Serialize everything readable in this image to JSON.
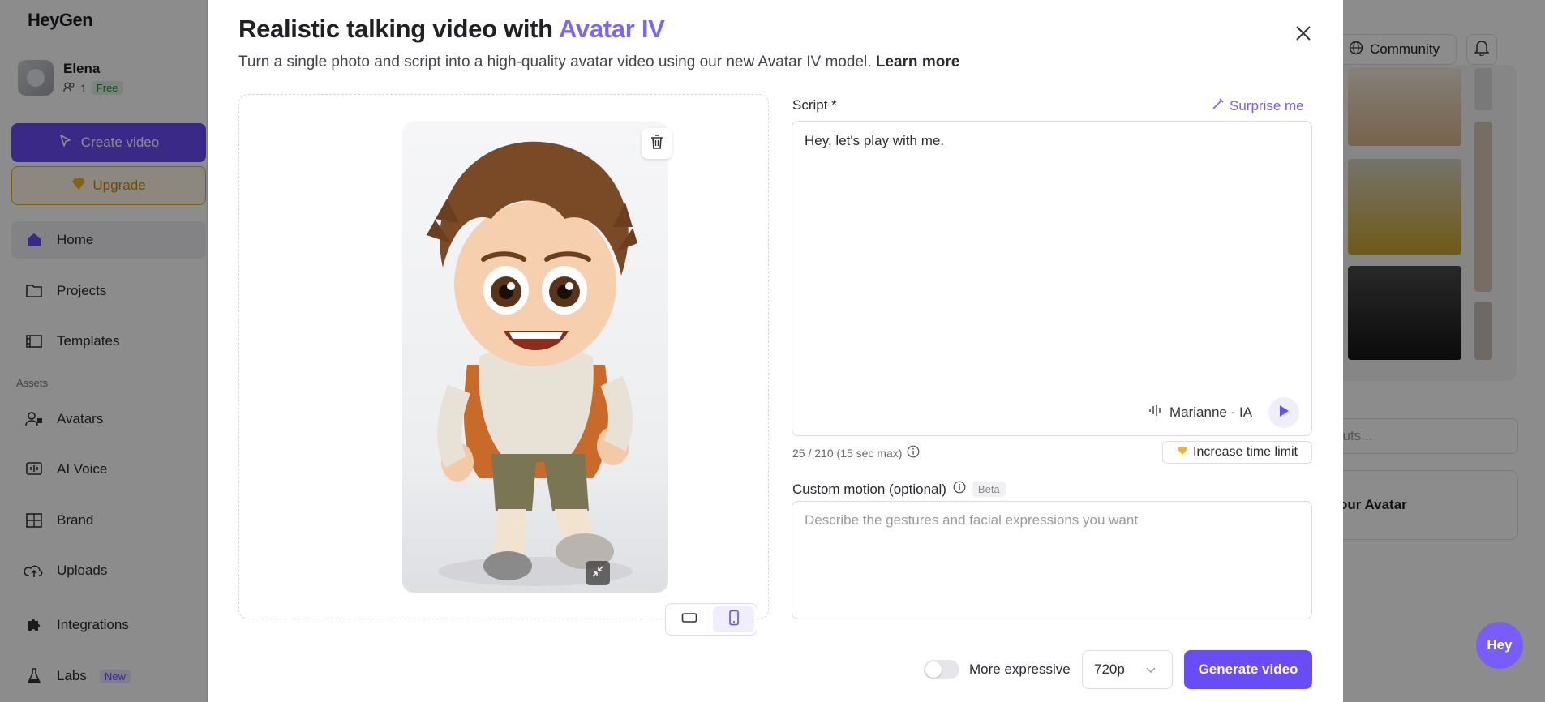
{
  "sidebar": {
    "logo": "HeyGen",
    "user": {
      "name": "Elena",
      "members": "1",
      "plan": "Free"
    },
    "create_label": "Create video",
    "upgrade_label": "Upgrade",
    "items": [
      {
        "label": "Home"
      },
      {
        "label": "Projects"
      },
      {
        "label": "Templates"
      },
      {
        "label": "Avatars"
      },
      {
        "label": "AI Voice"
      },
      {
        "label": "Brand"
      },
      {
        "label": "Uploads"
      },
      {
        "label": "Integrations"
      },
      {
        "label": "Labs",
        "badge": "New"
      }
    ],
    "assets_label": "Assets"
  },
  "background": {
    "community_label": "Community",
    "search_placeholder": "cuts...",
    "avatar_card_label": "our Avatar",
    "fab_label": "Hey"
  },
  "modal": {
    "title_prefix": "Realistic talking video with ",
    "title_accent": "Avatar IV",
    "subtitle": "Turn a single photo and script into a high-quality avatar video using our new Avatar IV model.",
    "learn_more": "Learn more",
    "script_label": "Script *",
    "surprise_label": "Surprise me",
    "script_text": "Hey, let's play with me.",
    "voice_name": "Marianne - IA",
    "char_count": "25 / 210 (15 sec max)",
    "time_limit_label": "Increase time limit",
    "motion_label": "Custom motion (optional)",
    "beta_label": "Beta",
    "motion_placeholder": "Describe the gestures and facial expressions you want",
    "expressive_label": "More expressive",
    "quality": "720p",
    "generate_label": "Generate video"
  },
  "colors": {
    "accent": "#6a4cf5",
    "title_accent": "#7a66f0",
    "upgrade": "#e3a826"
  }
}
